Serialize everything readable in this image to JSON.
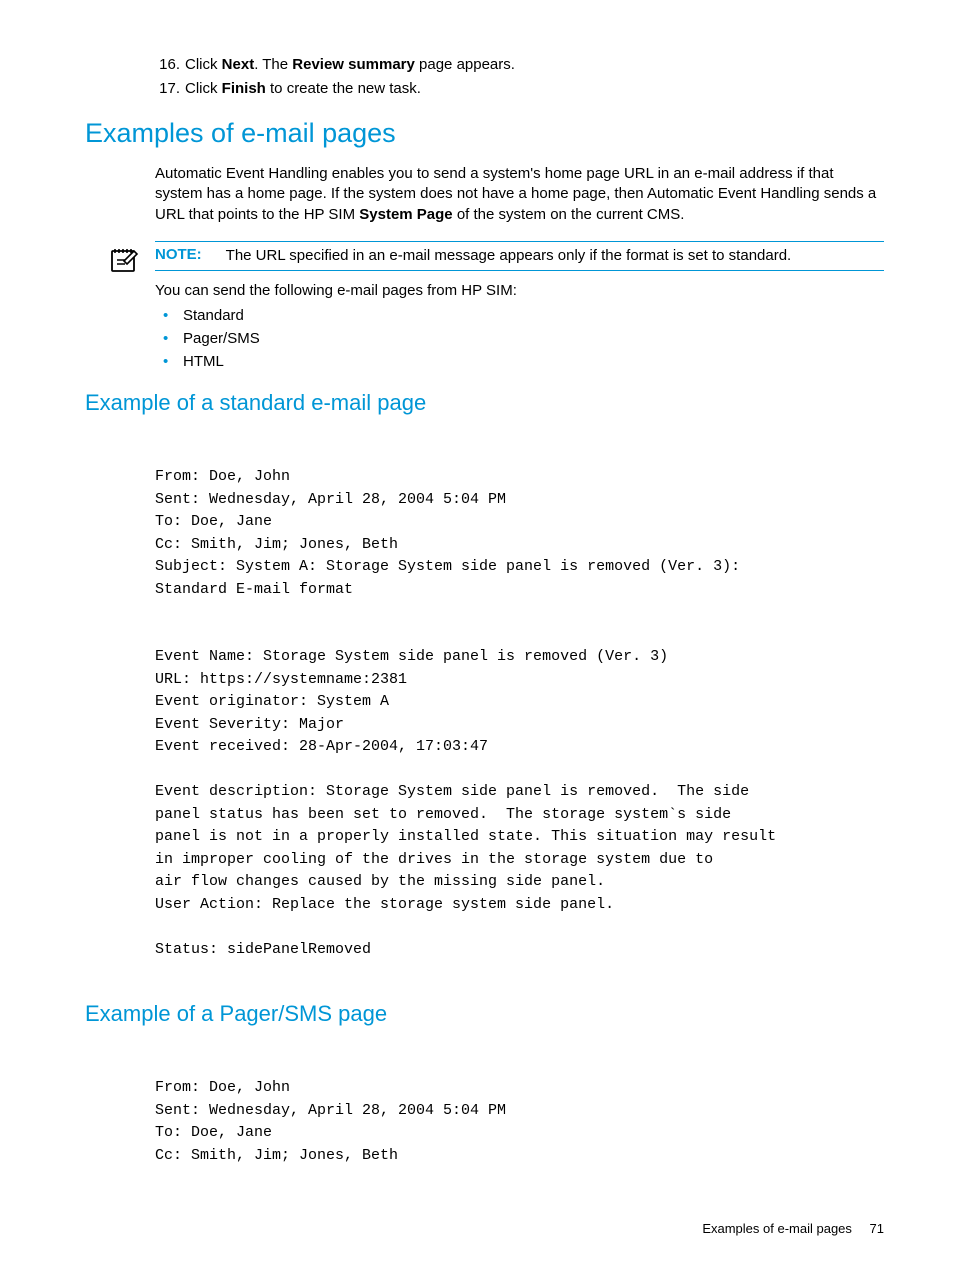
{
  "steps": [
    {
      "num": "16.",
      "pre": "Click ",
      "b1": "Next",
      "mid": ". The ",
      "b2": "Review summary",
      "post": " page appears."
    },
    {
      "num": "17.",
      "pre": "Click ",
      "b1": "Finish",
      "mid": " to create the new task.",
      "b2": "",
      "post": ""
    }
  ],
  "section_title": "Examples of e-mail pages",
  "intro_pre": "Automatic Event Handling enables you to send a system's home page URL in an e-mail address if that system has a home page. If the system does not have a home page, then Automatic Event Handling sends a URL that points to the HP SIM ",
  "intro_bold": "System Page",
  "intro_post": " of the system on the current CMS.",
  "note_label": "NOTE:",
  "note_text": "The URL specified in an e-mail message appears only if the format is set to standard.",
  "after_note": "You can send the following e-mail pages from HP SIM:",
  "bullets": [
    "Standard",
    "Pager/SMS",
    "HTML"
  ],
  "sub1_title": "Example of a standard e-mail page",
  "email1": "From: Doe, John\nSent: Wednesday, April 28, 2004 5:04 PM\nTo: Doe, Jane\nCc: Smith, Jim; Jones, Beth\nSubject: System A: Storage System side panel is removed (Ver. 3):\nStandard E-mail format\n\n\nEvent Name: Storage System side panel is removed (Ver. 3)\nURL: https://systemname:2381\nEvent originator: System A\nEvent Severity: Major\nEvent received: 28-Apr-2004, 17:03:47\n\nEvent description: Storage System side panel is removed.  The side\npanel status has been set to removed.  The storage system`s side\npanel is not in a properly installed state. This situation may result\nin improper cooling of the drives in the storage system due to\nair flow changes caused by the missing side panel.\nUser Action: Replace the storage system side panel.\n\nStatus: sidePanelRemoved",
  "sub2_title": "Example of a Pager/SMS page",
  "email2": "From: Doe, John\nSent: Wednesday, April 28, 2004 5:04 PM\nTo: Doe, Jane\nCc: Smith, Jim; Jones, Beth",
  "footer_text": "Examples of e-mail pages",
  "page_number": "71"
}
